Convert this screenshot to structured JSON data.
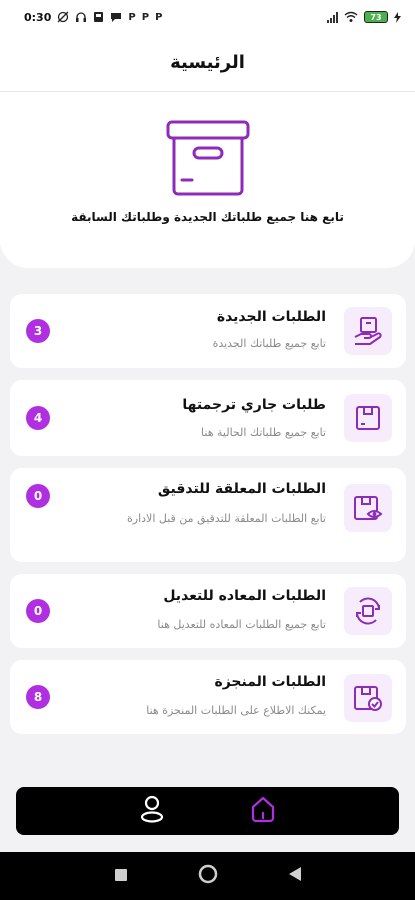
{
  "status_bar": {
    "time": "0:30",
    "left_glyphs": [
      "P",
      "P",
      "P"
    ],
    "battery": "73"
  },
  "header": {
    "title": "الرئيسية"
  },
  "hero": {
    "icon": "archive-box-icon",
    "text": "تابع هنا جميع طلباتك الجديدة وطلباتك السابقة"
  },
  "cards": [
    {
      "title": "الطلبات الجديدة",
      "subtitle": "تابع جميع طلباتك الجديدة",
      "count": "3",
      "icon": "hand-box-icon"
    },
    {
      "title": "طلبات جاري ترجمتها",
      "subtitle": "تابع جميع طلباتك الحالية هنا",
      "count": "4",
      "icon": "box-icon"
    },
    {
      "title": "الطلبات المعلقة للتدقيق",
      "subtitle": "تابع الطلبات المعلقة للتدقيق من قبل الادارة",
      "count": "0",
      "icon": "box-eye-icon"
    },
    {
      "title": "الطلبات المعاده للتعديل",
      "subtitle": "تابع جميع الطلبات المعاده للتعديل هنا",
      "count": "0",
      "icon": "box-cycle-icon"
    },
    {
      "title": "الطلبات المنجزة",
      "subtitle": "يمكنك الاطلاع على الطلبات المنجزة هنا",
      "count": "8",
      "icon": "box-check-icon"
    }
  ],
  "bottom_nav": {
    "items": [
      {
        "icon": "profile-icon",
        "active": false
      },
      {
        "icon": "home-icon",
        "active": true
      }
    ]
  },
  "colors": {
    "accent": "#b02fe0",
    "icon_purple": "#8e2bb8",
    "icon_bg": "#f7ecfb"
  }
}
